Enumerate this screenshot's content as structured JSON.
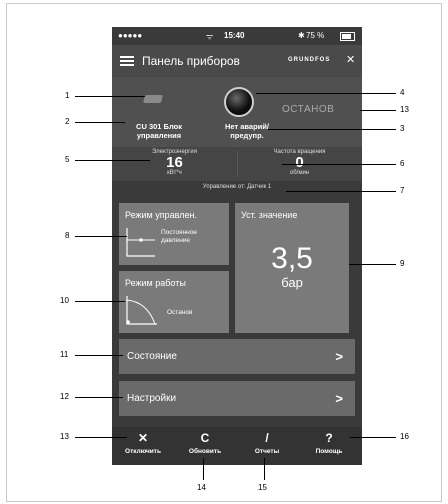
{
  "status_bar": {
    "signal": "●●●●●",
    "wifi": "ᯤ",
    "time": "15:40",
    "bt": "✱",
    "battery": "75 %"
  },
  "nav": {
    "title": "Панель приборов",
    "logo": "GRUNDFOS"
  },
  "top": {
    "cu_label": "CU 301 Блок управления",
    "alarm": "Нет аварий/ предупр.",
    "stop": "ОСТАНОВ"
  },
  "metrics": [
    {
      "label": "Электроэнергия",
      "value": "16",
      "unit": "кВт*ч"
    },
    {
      "label": "Частота вращения",
      "value": "0",
      "unit": "об/мин"
    }
  ],
  "control_source": "Управление от: Датчик 1",
  "tiles": {
    "control_mode": {
      "title": "Режим управлен.",
      "value": "Постоянное давление"
    },
    "setpoint": {
      "title": "Уст. значение",
      "value": "3,5",
      "unit": "бар"
    },
    "operating_mode": {
      "title": "Режим работы",
      "value": "Останов"
    }
  },
  "rows": [
    {
      "label": "Состояние",
      "chevron": ">"
    },
    {
      "label": "Настройки",
      "chevron": ">"
    }
  ],
  "tabs": [
    {
      "icon": "✕",
      "label": "Отключить"
    },
    {
      "icon": "C",
      "label": "Обновить"
    },
    {
      "icon": "/",
      "label": "Отчеты"
    },
    {
      "icon": "?",
      "label": "Помощь"
    }
  ],
  "callouts": [
    "1",
    "2",
    "3",
    "4",
    "5",
    "6",
    "7",
    "8",
    "9",
    "10",
    "11",
    "12",
    "13",
    "13",
    "14",
    "15",
    "16"
  ]
}
